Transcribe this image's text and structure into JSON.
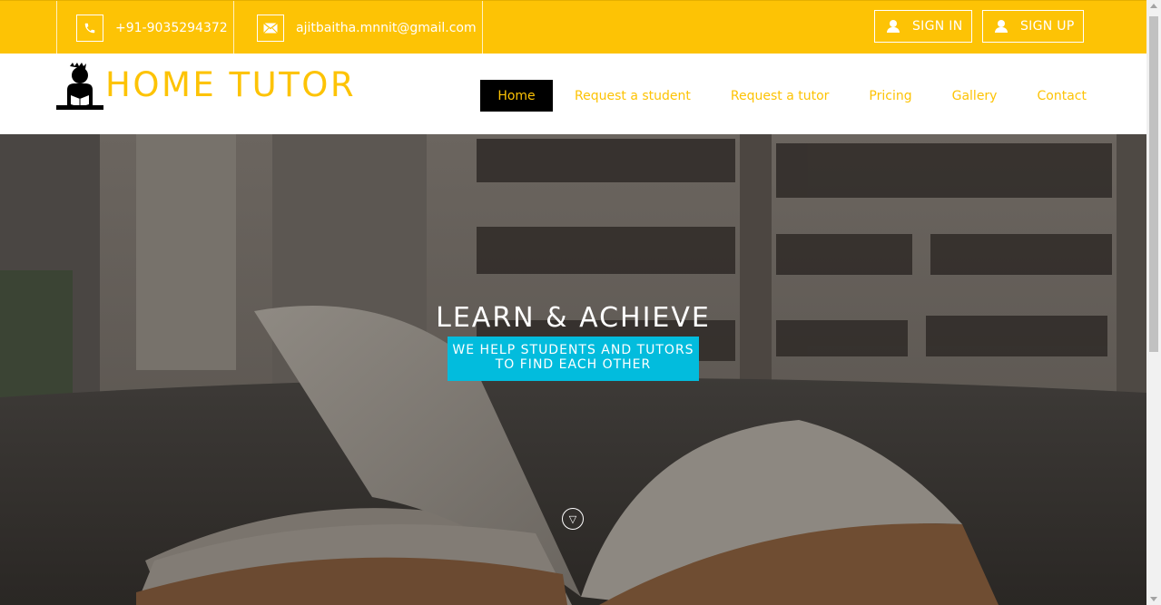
{
  "topbar": {
    "phone": {
      "icon": "phone-icon",
      "text": "+91-9035294372"
    },
    "email": {
      "icon": "envelope-icon",
      "text": "ajitbaitha.mnnit@gmail.com"
    },
    "sign_in_label": "SIGN IN",
    "sign_up_label": "SIGN UP"
  },
  "brand": {
    "name": "HOME TUTOR",
    "logo_icon": "tutor-reading-icon"
  },
  "nav": {
    "items": [
      {
        "label": "Home",
        "active": true
      },
      {
        "label": "Request a student",
        "active": false
      },
      {
        "label": "Request a tutor",
        "active": false
      },
      {
        "label": "Pricing",
        "active": false
      },
      {
        "label": "Gallery",
        "active": false
      },
      {
        "label": "Contact",
        "active": false
      }
    ]
  },
  "hero": {
    "title": "LEARN & ACHIEVE",
    "subtitle_line1": "WE HELP STUDENTS AND TUTORS",
    "subtitle_line2": "TO FIND EACH OTHER",
    "scroll_icon": "chevron-down-circle-icon"
  },
  "colors": {
    "accent": "#fdc305",
    "cyan": "#02bcdd",
    "nav_active_bg": "#000000"
  }
}
